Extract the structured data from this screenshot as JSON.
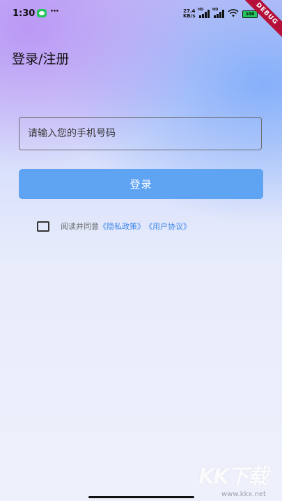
{
  "status_bar": {
    "time": "1:30",
    "more": "···",
    "speed_value": "27.4",
    "speed_unit": "KB/s",
    "signal_1_label": "HD",
    "signal_2_label": "HD",
    "battery": "100",
    "debug": "DEBUG"
  },
  "header": {
    "title": "登录/注册"
  },
  "form": {
    "phone_placeholder": "请输入您的手机号码",
    "login_label": "登录"
  },
  "agreement": {
    "prefix": "阅读并同意",
    "privacy_link": "《隐私政策》",
    "user_link": "《用户协议》",
    "checked": false
  },
  "watermark": {
    "logo": "KK下载",
    "url": "www.kkx.net"
  }
}
